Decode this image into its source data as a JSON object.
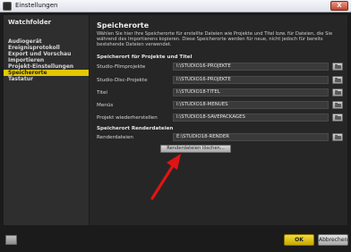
{
  "window": {
    "title": "Einstellungen",
    "close_label": "X"
  },
  "sidebar": {
    "heading": "Watchfolder",
    "items": [
      {
        "label": "Audiogerät",
        "active": false
      },
      {
        "label": "Ereignisprotokoll",
        "active": false
      },
      {
        "label": "Export und Vorschau",
        "active": false
      },
      {
        "label": "Importieren",
        "active": false
      },
      {
        "label": "Projekt-Einstellungen",
        "active": false
      },
      {
        "label": "Speicherorte",
        "active": true
      },
      {
        "label": "Tastatur",
        "active": false
      }
    ]
  },
  "panel": {
    "title": "Speicherorte",
    "description": "Wählen Sie hier Ihre Speicherorte für erstellte Dateien wie Projekte und Titel bzw. für Dateien, die Sie während des Importierens kopieren. Diese Speicherorte werden für neue, nicht jedoch für bereits bestehende Dateien verwendet.",
    "section1_title": "Speicherort für Projekte und Titel",
    "rows": [
      {
        "label": "Studio-Filmprojekte",
        "value": "I:\\STUDIO16-PROJEKTE"
      },
      {
        "label": "Studio-Disc-Projekte",
        "value": "I:\\STUDIO16-PROJEKTE"
      },
      {
        "label": "Titel",
        "value": "I:\\STUDIO18-TITEL"
      },
      {
        "label": "Menüs",
        "value": "I:\\STUDIO18-MENUES"
      },
      {
        "label": "Projekt wiederherstellen",
        "value": "I:\\STUDIO18-SAVEPACKAGES"
      }
    ],
    "section2_title": "Speicherort Renderdateien",
    "render": {
      "label": "Renderdateien",
      "value": "E:\\STUDIO18-RENDER"
    },
    "clear_cache_label": "Renderdateien löschen..."
  },
  "footer": {
    "ok_label": "OK",
    "cancel_label": "Abbrechen"
  },
  "colors": {
    "accent": "#e2c800",
    "annotation_arrow": "#e01414"
  }
}
